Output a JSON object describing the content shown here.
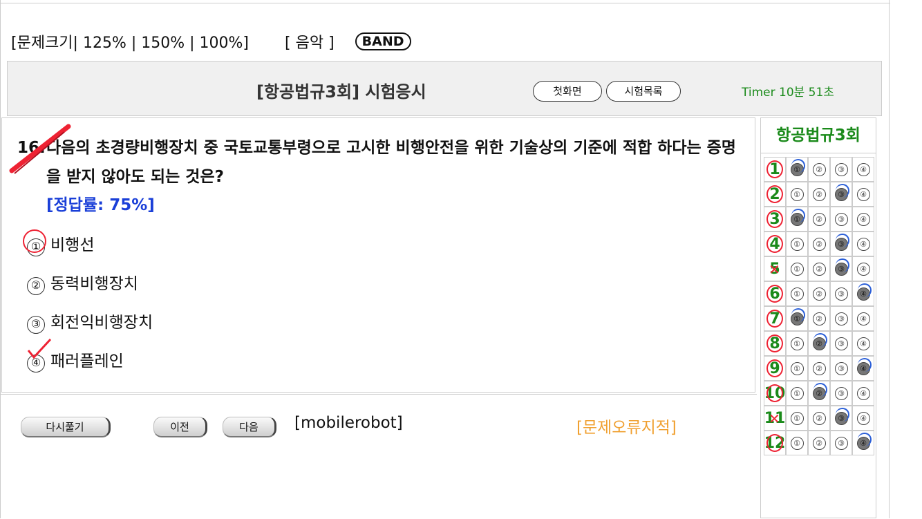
{
  "toolbar": {
    "size_label": "[문제크기| 125% | 150% | 100%]",
    "music_label": "[ 음악 ]",
    "band_label": "BAND"
  },
  "header": {
    "title": "[항공법규3회] 시험응시",
    "home_button": "첫화면",
    "list_button": "시험목록",
    "timer": "Timer 10분 51초"
  },
  "question": {
    "number": "16.",
    "text": "다음의 초경량비행장치 중 국토교통부령으로 고시한 비행안전을 위한 기술상의 기준에 적합 하다는 증명을 받지 않아도 되는 것은?",
    "rate": "[정답률: 75%]",
    "options": [
      {
        "mark": "①",
        "label": "비행선"
      },
      {
        "mark": "②",
        "label": "동력비행장치"
      },
      {
        "mark": "③",
        "label": "회전익비행장치"
      },
      {
        "mark": "④",
        "label": "패러플레인"
      }
    ]
  },
  "bottom": {
    "retry_button": "다시풀기",
    "prev_button": "이전",
    "next_button": "다음",
    "user": "[mobilerobot]",
    "report_link": "[문제오류지적]"
  },
  "panel": {
    "title": "항공법규3회",
    "rows": [
      {
        "num": "1",
        "result": "correct",
        "selected": 1
      },
      {
        "num": "2",
        "result": "correct",
        "selected": 3
      },
      {
        "num": "3",
        "result": "correct",
        "selected": 1
      },
      {
        "num": "4",
        "result": "correct",
        "selected": 3
      },
      {
        "num": "5",
        "result": "wrong",
        "selected": 3
      },
      {
        "num": "6",
        "result": "correct",
        "selected": 4
      },
      {
        "num": "7",
        "result": "correct",
        "selected": 1
      },
      {
        "num": "8",
        "result": "correct",
        "selected": 2
      },
      {
        "num": "9",
        "result": "correct",
        "selected": 4
      },
      {
        "num": "10",
        "result": "correct",
        "selected": 2
      },
      {
        "num": "11",
        "result": "wrong",
        "selected": 3
      },
      {
        "num": "12",
        "result": "correct",
        "selected": 4
      }
    ],
    "choices": [
      "①",
      "②",
      "③",
      "④"
    ]
  }
}
